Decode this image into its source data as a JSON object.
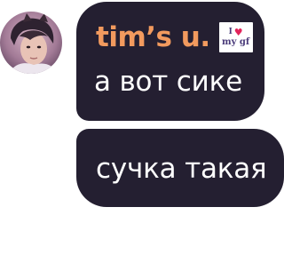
{
  "messages": [
    {
      "sender": "tim’s u.",
      "badge": {
        "top": "I",
        "heart": "♥",
        "bottom": "my gf"
      },
      "text": "а вот сике"
    },
    {
      "text": "сучка такая"
    }
  ],
  "colors": {
    "bubble_bg": "#241f31",
    "sender_name": "#f29a5e",
    "message_text": "#ffffff",
    "badge_heart": "#e2245b",
    "page_bg": "#ffffff"
  },
  "icons": {
    "avatar": "user-avatar-photo",
    "badge": "i-love-my-gf-sticker"
  }
}
